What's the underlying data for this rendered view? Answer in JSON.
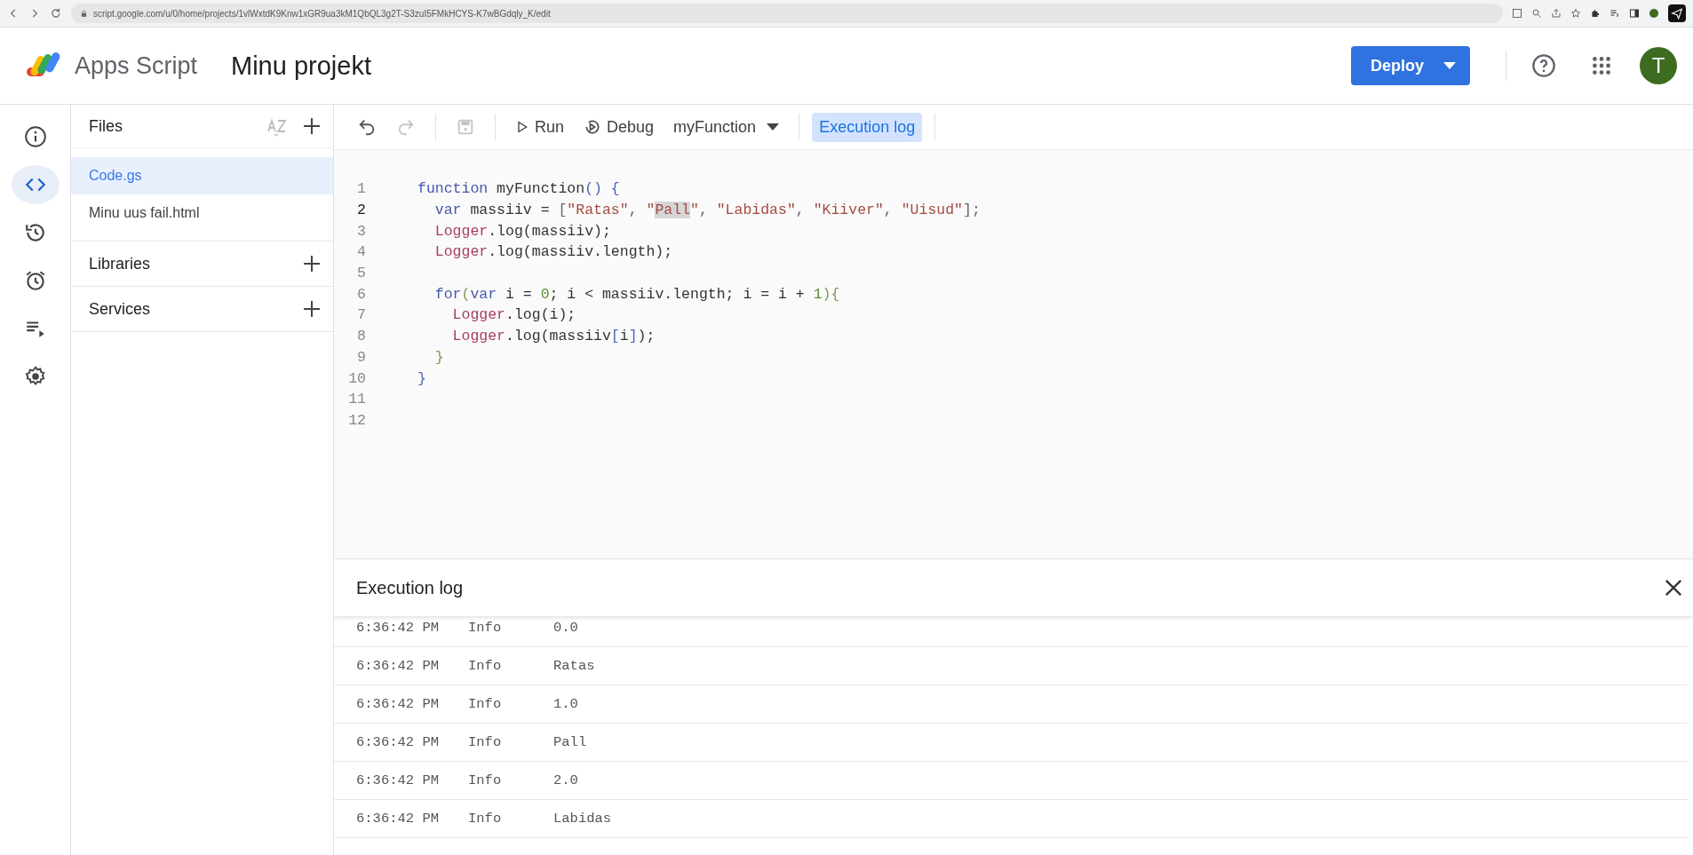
{
  "browser": {
    "url": "script.google.com/u/0/home/projects/1vlWxtdK9Knw1xGR9ua3kM1QbQL3g2T-S3zuI5FMkHCYS-K7wBGdqly_K/edit"
  },
  "header": {
    "product": "Apps Script",
    "project": "Minu projekt",
    "deploy": "Deploy",
    "avatar": "T"
  },
  "rail": [
    {
      "selected": false
    },
    {
      "selected": true
    },
    {
      "selected": false
    },
    {
      "selected": false
    },
    {
      "selected": false
    },
    {
      "selected": false
    }
  ],
  "files": {
    "title": "Files",
    "items": [
      {
        "name": "Code.gs",
        "selected": true
      },
      {
        "name": "Minu uus fail.html",
        "selected": false
      }
    ],
    "sections": [
      "Libraries",
      "Services"
    ]
  },
  "toolbar": {
    "undo": {
      "disabled": false
    },
    "redo": {
      "disabled": true
    },
    "save": {
      "disabled": true
    },
    "run": "Run",
    "debug": "Debug",
    "function": "myFunction",
    "log_toggle": {
      "label": "Execution log",
      "on": true
    }
  },
  "editor": {
    "lines": [
      {
        "number": "1",
        "current": false,
        "tokens": [
          {
            "text": "function",
            "kind": "kw"
          },
          {
            "text": " myFunction",
            "kind": "plain"
          },
          {
            "text": "()",
            "kind": "bracket"
          },
          {
            "text": " {",
            "kind": "bracket"
          }
        ]
      },
      {
        "number": "2",
        "current": true,
        "tokens": [
          {
            "text": "  var",
            "kind": "kw"
          },
          {
            "text": " massiiv = ",
            "kind": "plain"
          },
          {
            "text": "[",
            "kind": "punc"
          },
          {
            "text": "\"Ratas\"",
            "kind": "str"
          },
          {
            "text": ", ",
            "kind": "punc"
          },
          {
            "text": "\"",
            "kind": "str"
          },
          {
            "text": "Pall",
            "kind": "match"
          },
          {
            "text": "\"",
            "kind": "str"
          },
          {
            "text": ", ",
            "kind": "punc"
          },
          {
            "text": "\"Labidas\"",
            "kind": "str"
          },
          {
            "text": ", ",
            "kind": "punc"
          },
          {
            "text": "\"Kiiver\"",
            "kind": "str"
          },
          {
            "text": ", ",
            "kind": "punc"
          },
          {
            "text": "\"Uisud\"",
            "kind": "str"
          },
          {
            "text": "];",
            "kind": "punc"
          }
        ]
      },
      {
        "number": "3",
        "current": false,
        "tokens": [
          {
            "text": "  Logger",
            "kind": "obj"
          },
          {
            "text": ".log(massiiv);",
            "kind": "plain"
          }
        ]
      },
      {
        "number": "4",
        "current": false,
        "tokens": [
          {
            "text": "  Logger",
            "kind": "obj"
          },
          {
            "text": ".log(massiiv.length);",
            "kind": "plain"
          }
        ]
      },
      {
        "number": "5",
        "current": false
      },
      {
        "number": "6",
        "current": false,
        "tokens": [
          {
            "text": "  for",
            "kind": "kw"
          },
          {
            "text": "(",
            "kind": "brace"
          },
          {
            "text": "var",
            "kind": "kw"
          },
          {
            "text": " i = ",
            "kind": "plain"
          },
          {
            "text": "0",
            "kind": "num"
          },
          {
            "text": "; i < massiiv.length; i = i + ",
            "kind": "plain"
          },
          {
            "text": "1",
            "kind": "num"
          },
          {
            "text": "){",
            "kind": "brace"
          }
        ]
      },
      {
        "number": "7",
        "current": false,
        "tokens": [
          {
            "text": "    Logger",
            "kind": "obj"
          },
          {
            "text": ".log(i);",
            "kind": "plain"
          }
        ]
      },
      {
        "number": "8",
        "current": false,
        "tokens": [
          {
            "text": "    Logger",
            "kind": "obj"
          },
          {
            "text": ".log(massiiv",
            "kind": "plain"
          },
          {
            "text": "[",
            "kind": "bracket"
          },
          {
            "text": "i",
            "kind": "plain"
          },
          {
            "text": "]",
            "kind": "bracket"
          },
          {
            "text": ");",
            "kind": "plain"
          }
        ]
      },
      {
        "number": "9",
        "current": false,
        "tokens": [
          {
            "text": "  }",
            "kind": "brace"
          }
        ]
      },
      {
        "number": "10",
        "current": false,
        "tokens": [
          {
            "text": "}",
            "kind": "bracket"
          }
        ]
      },
      {
        "number": "11",
        "current": false
      },
      {
        "number": "12",
        "current": false
      }
    ]
  },
  "log": {
    "title": "Execution log",
    "rows": [
      {
        "time": "6:36:42 PM",
        "level": "Info",
        "message": "0.0"
      },
      {
        "time": "6:36:42 PM",
        "level": "Info",
        "message": "Ratas"
      },
      {
        "time": "6:36:42 PM",
        "level": "Info",
        "message": "1.0"
      },
      {
        "time": "6:36:42 PM",
        "level": "Info",
        "message": "Pall"
      },
      {
        "time": "6:36:42 PM",
        "level": "Info",
        "message": "2.0"
      },
      {
        "time": "6:36:42 PM",
        "level": "Info",
        "message": "Labidas"
      }
    ]
  }
}
